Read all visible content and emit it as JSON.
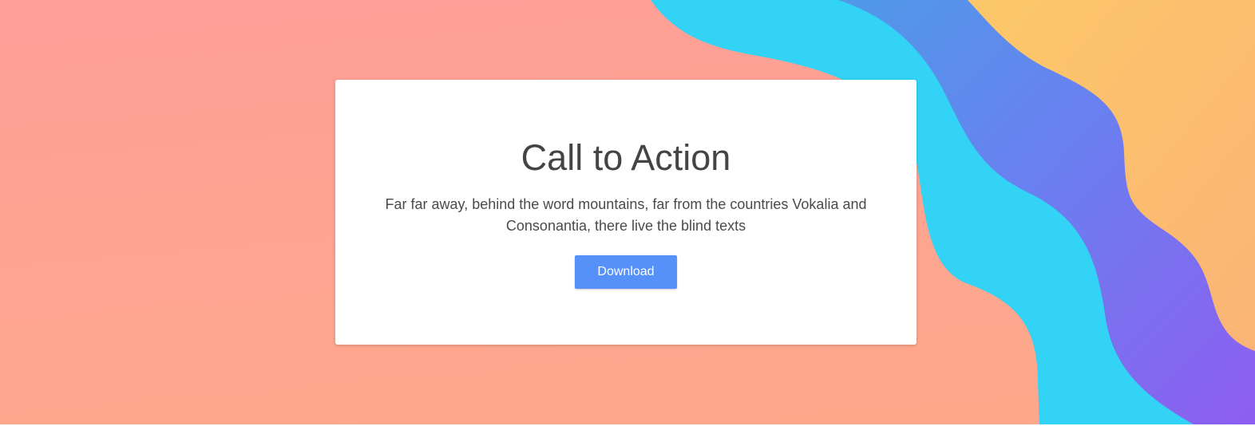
{
  "hero": {
    "title": "Call to Action",
    "text": "Far far away, behind the word mountains, far from the countries Vokalia and Consonantia, there live the blind texts",
    "button_label": "Download"
  },
  "colors": {
    "background_top": "#ff9e98",
    "background_bottom": "#fda98a",
    "wave_cyan": "#33d3f5",
    "wave_blue": "#5a8be8",
    "wave_purple": "#8a5cf0",
    "wave_orange": "#fbbf6b",
    "button": "#5591f8",
    "title_text": "#444444"
  }
}
